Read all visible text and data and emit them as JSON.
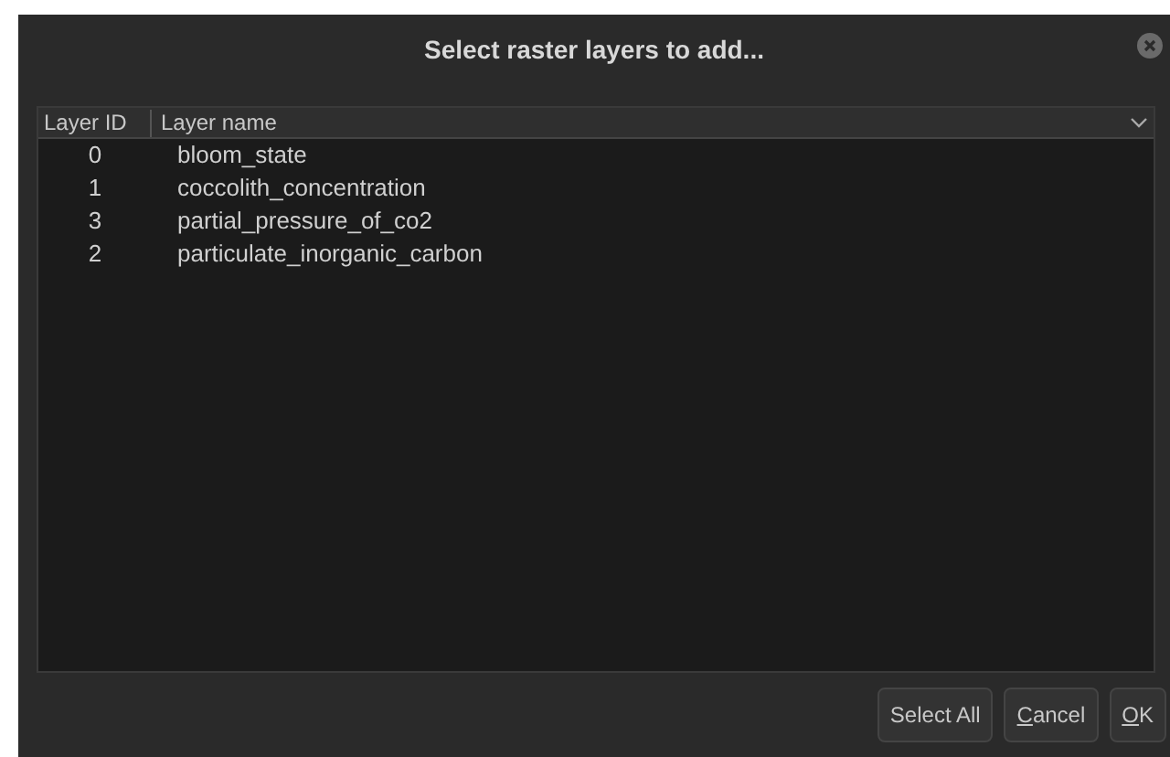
{
  "window": {
    "title": "Select raster layers to add..."
  },
  "table": {
    "columns": [
      "Layer ID",
      "Layer name"
    ],
    "rows": [
      {
        "id": "0",
        "name": "bloom_state",
        "selected": false
      },
      {
        "id": "1",
        "name": "coccolith_concentration",
        "selected": false
      },
      {
        "id": "3",
        "name": "partial_pressure_of_co2",
        "selected": false
      },
      {
        "id": "2",
        "name": "particulate_inorganic_carbon",
        "selected": false
      }
    ]
  },
  "buttons": [
    {
      "label": "Select All",
      "underline_first": false
    },
    {
      "label": "Cancel",
      "underline_first": true
    },
    {
      "label": "OK",
      "underline_first": true
    }
  ]
}
